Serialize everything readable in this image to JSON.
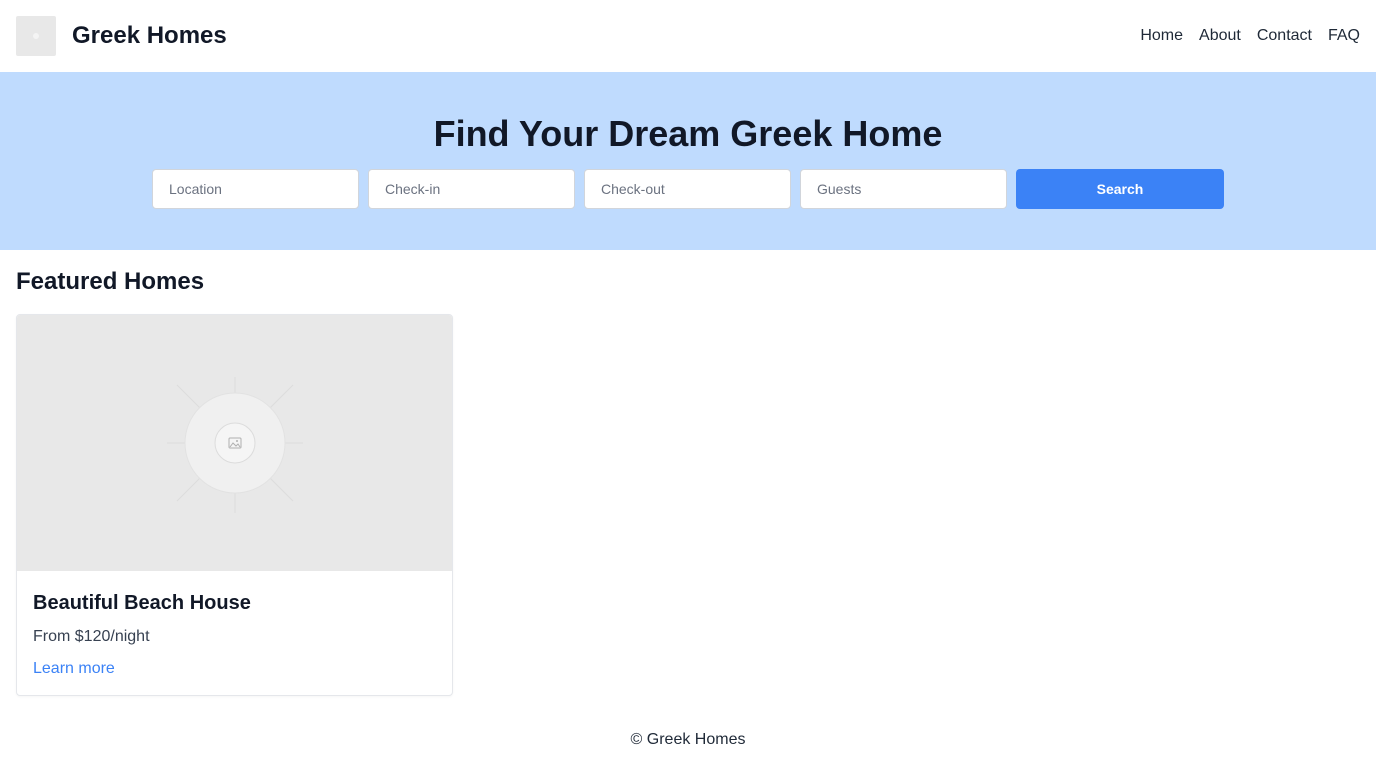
{
  "header": {
    "brand": "Greek Homes",
    "nav": [
      "Home",
      "About",
      "Contact",
      "FAQ"
    ]
  },
  "hero": {
    "title": "Find Your Dream Greek Home",
    "search": {
      "location_placeholder": "Location",
      "checkin_placeholder": "Check-in",
      "checkout_placeholder": "Check-out",
      "guests_placeholder": "Guests",
      "button_label": "Search"
    }
  },
  "featured": {
    "title": "Featured Homes",
    "cards": [
      {
        "image_icon": "image-placeholder-icon",
        "title": "Beautiful Beach House",
        "price": "From $120/night",
        "link": "Learn more"
      }
    ]
  },
  "footer": {
    "text": "© Greek Homes"
  },
  "colors": {
    "hero_bg": "#bfdbfe",
    "accent": "#3b82f6",
    "text": "#111827"
  }
}
